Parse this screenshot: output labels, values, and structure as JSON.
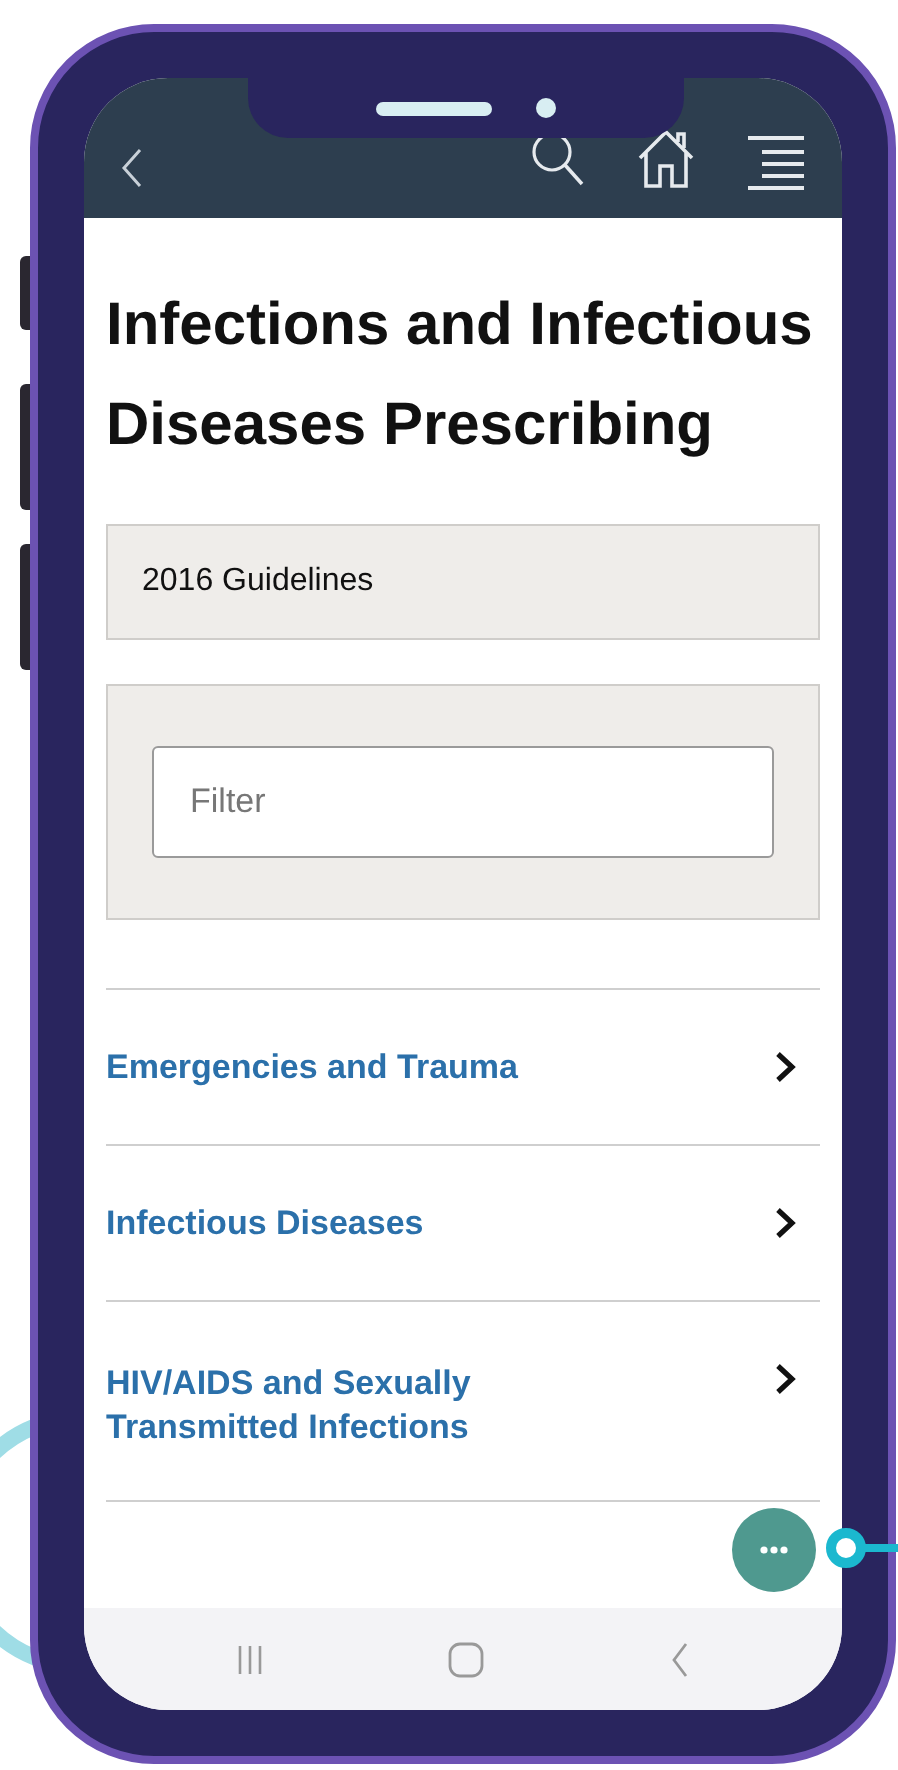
{
  "page": {
    "title": "Infections and Infectious Diseases Prescribing"
  },
  "guidelines": {
    "label": "2016 Guidelines"
  },
  "filter": {
    "placeholder": "Filter"
  },
  "items": [
    {
      "label": "Emergencies and Trauma"
    },
    {
      "label": "Infectious Diseases"
    },
    {
      "label": "HIV/AIDS and Sexually Transmitted Infections"
    }
  ]
}
